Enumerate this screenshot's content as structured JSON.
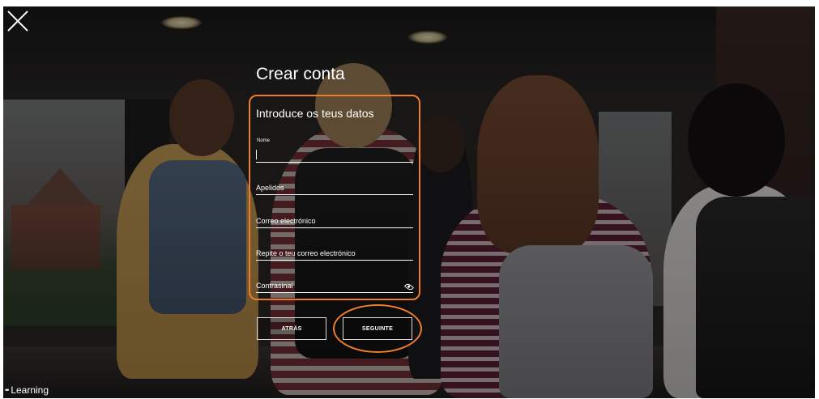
{
  "page": {
    "title": "Crear conta",
    "subtitle": "Introduce os teus datos"
  },
  "form": {
    "name_label": "Nome",
    "fields": [
      {
        "label": "Apelidos"
      },
      {
        "label": "Correo electrónico"
      },
      {
        "label": "Repite o teu correo electrónico"
      },
      {
        "label": "Contrasinal"
      }
    ]
  },
  "buttons": {
    "back_label": "ATRÁS",
    "next_label": "SEGUINTE"
  },
  "brand": {
    "text": "Learning",
    "dots": "••"
  },
  "icons": {
    "close": "close-icon",
    "eye": "eye-icon"
  },
  "colors": {
    "highlight": "#ee7d2b",
    "text": "#ffffff"
  }
}
